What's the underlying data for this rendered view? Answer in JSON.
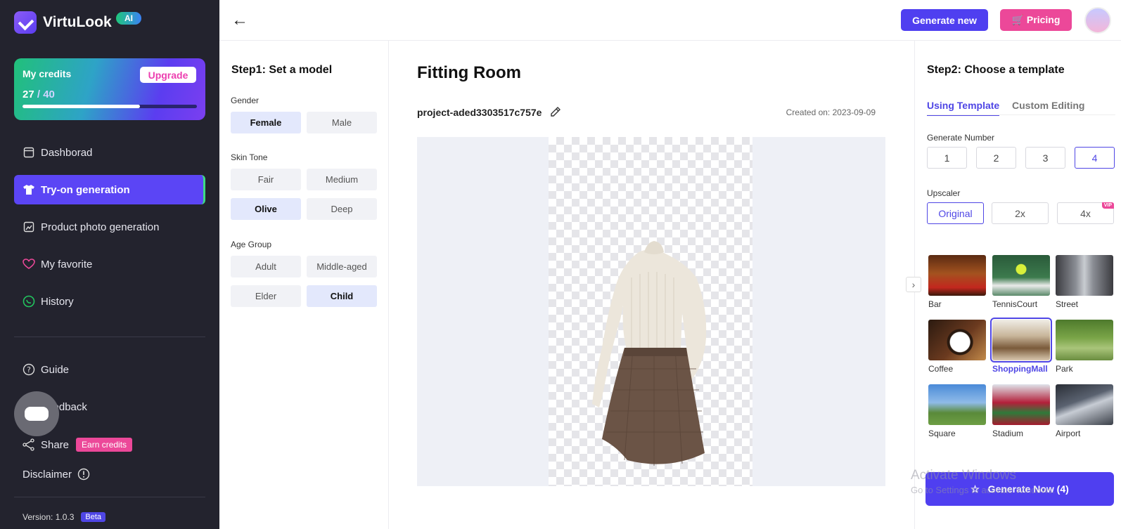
{
  "app": {
    "name": "VirtuLook",
    "badge": "AI"
  },
  "credits": {
    "title": "My credits",
    "upgrade": "Upgrade",
    "used": "27",
    "total": "/ 40",
    "progress": 0.675
  },
  "nav": [
    {
      "label": "Dashborad",
      "icon": "dashboard-icon"
    },
    {
      "label": "Try-on generation",
      "icon": "shirt-icon",
      "active": true
    },
    {
      "label": "Product photo generation",
      "icon": "photo-icon"
    },
    {
      "label": "My favorite",
      "icon": "heart-icon"
    },
    {
      "label": "History",
      "icon": "history-icon"
    }
  ],
  "nav_bottom": {
    "guide": "Guide",
    "feedback": "Feedback",
    "share": "Share",
    "earn": "Earn credits",
    "disclaimer": "Disclaimer",
    "version": "Version: 1.0.3",
    "beta": "Beta"
  },
  "topbar": {
    "generate_new": "Generate new",
    "pricing": "Pricing"
  },
  "step1": {
    "title": "Step1: Set a model",
    "gender_label": "Gender",
    "gender": [
      "Female",
      "Male"
    ],
    "skin_label": "Skin Tone",
    "skin": [
      "Fair",
      "Medium",
      "Olive",
      "Deep"
    ],
    "age_label": "Age Group",
    "age": [
      "Adult",
      "Middle-aged",
      "Elder",
      "Child"
    ]
  },
  "main": {
    "title": "Fitting Room",
    "project": "project-aded3303517c757e",
    "created": "Created on:  2023-09-09"
  },
  "step2": {
    "title": "Step2: Choose a template",
    "tabs": [
      "Using Template",
      "Custom Editing"
    ],
    "number_label": "Generate Number",
    "numbers": [
      "1",
      "2",
      "3",
      "4"
    ],
    "upscaler_label": "Upscaler",
    "upscalers": [
      "Original",
      "2x",
      "4x"
    ],
    "vip": "VIP",
    "templates": [
      "Bar",
      "TennisCourt",
      "Street",
      "Coffee",
      "ShoppingMall",
      "Park",
      "Square",
      "Stadium",
      "Airport"
    ],
    "generate_now": "Generate Now (4)"
  },
  "watermark": {
    "line1": "Activate Windows",
    "line2": "Go to Settings to activate Windows."
  }
}
